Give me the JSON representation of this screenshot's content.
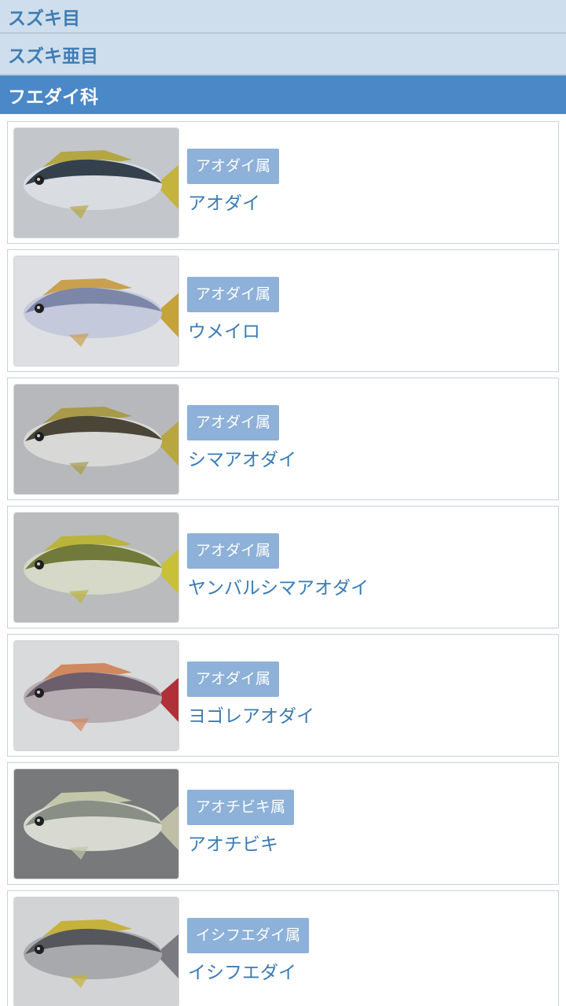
{
  "categories": {
    "order": "スズキ目",
    "suborder": "スズキ亜目",
    "family": "フエダイ科"
  },
  "fish": [
    {
      "genus": "アオダイ属",
      "name": "アオダイ",
      "icon": "fish-photo",
      "colors": {
        "bg": "#c3c6ca",
        "body": "#d9dde2",
        "back": "#34404c",
        "fin": "#b4a642",
        "tail": "#c4b43e"
      }
    },
    {
      "genus": "アオダイ属",
      "name": "ウメイロ",
      "icon": "fish-photo",
      "colors": {
        "bg": "#dedfe2",
        "body": "#c4c9db",
        "back": "#7c86a8",
        "fin": "#c9a050",
        "tail": "#c6a23a"
      }
    },
    {
      "genus": "アオダイ属",
      "name": "シマアオダイ",
      "icon": "fish-photo",
      "colors": {
        "bg": "#b6b8bb",
        "body": "#d8d9d6",
        "back": "#4a4536",
        "fin": "#a89a4a",
        "tail": "#b8a640"
      }
    },
    {
      "genus": "アオダイ属",
      "name": "ヤンバルシマアオダイ",
      "icon": "fish-photo",
      "colors": {
        "bg": "#b9bbbd",
        "body": "#d6d8c8",
        "back": "#717a3a",
        "fin": "#bab43a",
        "tail": "#c9c03a"
      }
    },
    {
      "genus": "アオダイ属",
      "name": "ヨゴレアオダイ",
      "icon": "fish-photo",
      "colors": {
        "bg": "#d9dadb",
        "body": "#b5adb2",
        "back": "#6c5e6a",
        "fin": "#d08860",
        "tail": "#b0303a"
      }
    },
    {
      "genus": "アオチビキ属",
      "name": "アオチビキ",
      "icon": "fish-photo",
      "colors": {
        "bg": "#77797b",
        "body": "#d8dad2",
        "back": "#8a8f86",
        "fin": "#c3c6a8",
        "tail": "#bfbfa8"
      }
    },
    {
      "genus": "イシフエダイ属",
      "name": "イシフエダイ",
      "icon": "fish-photo",
      "colors": {
        "bg": "#d1d3d5",
        "body": "#a8a9ac",
        "back": "#56575c",
        "fin": "#c6b13a",
        "tail": "#7a7a80"
      }
    }
  ]
}
